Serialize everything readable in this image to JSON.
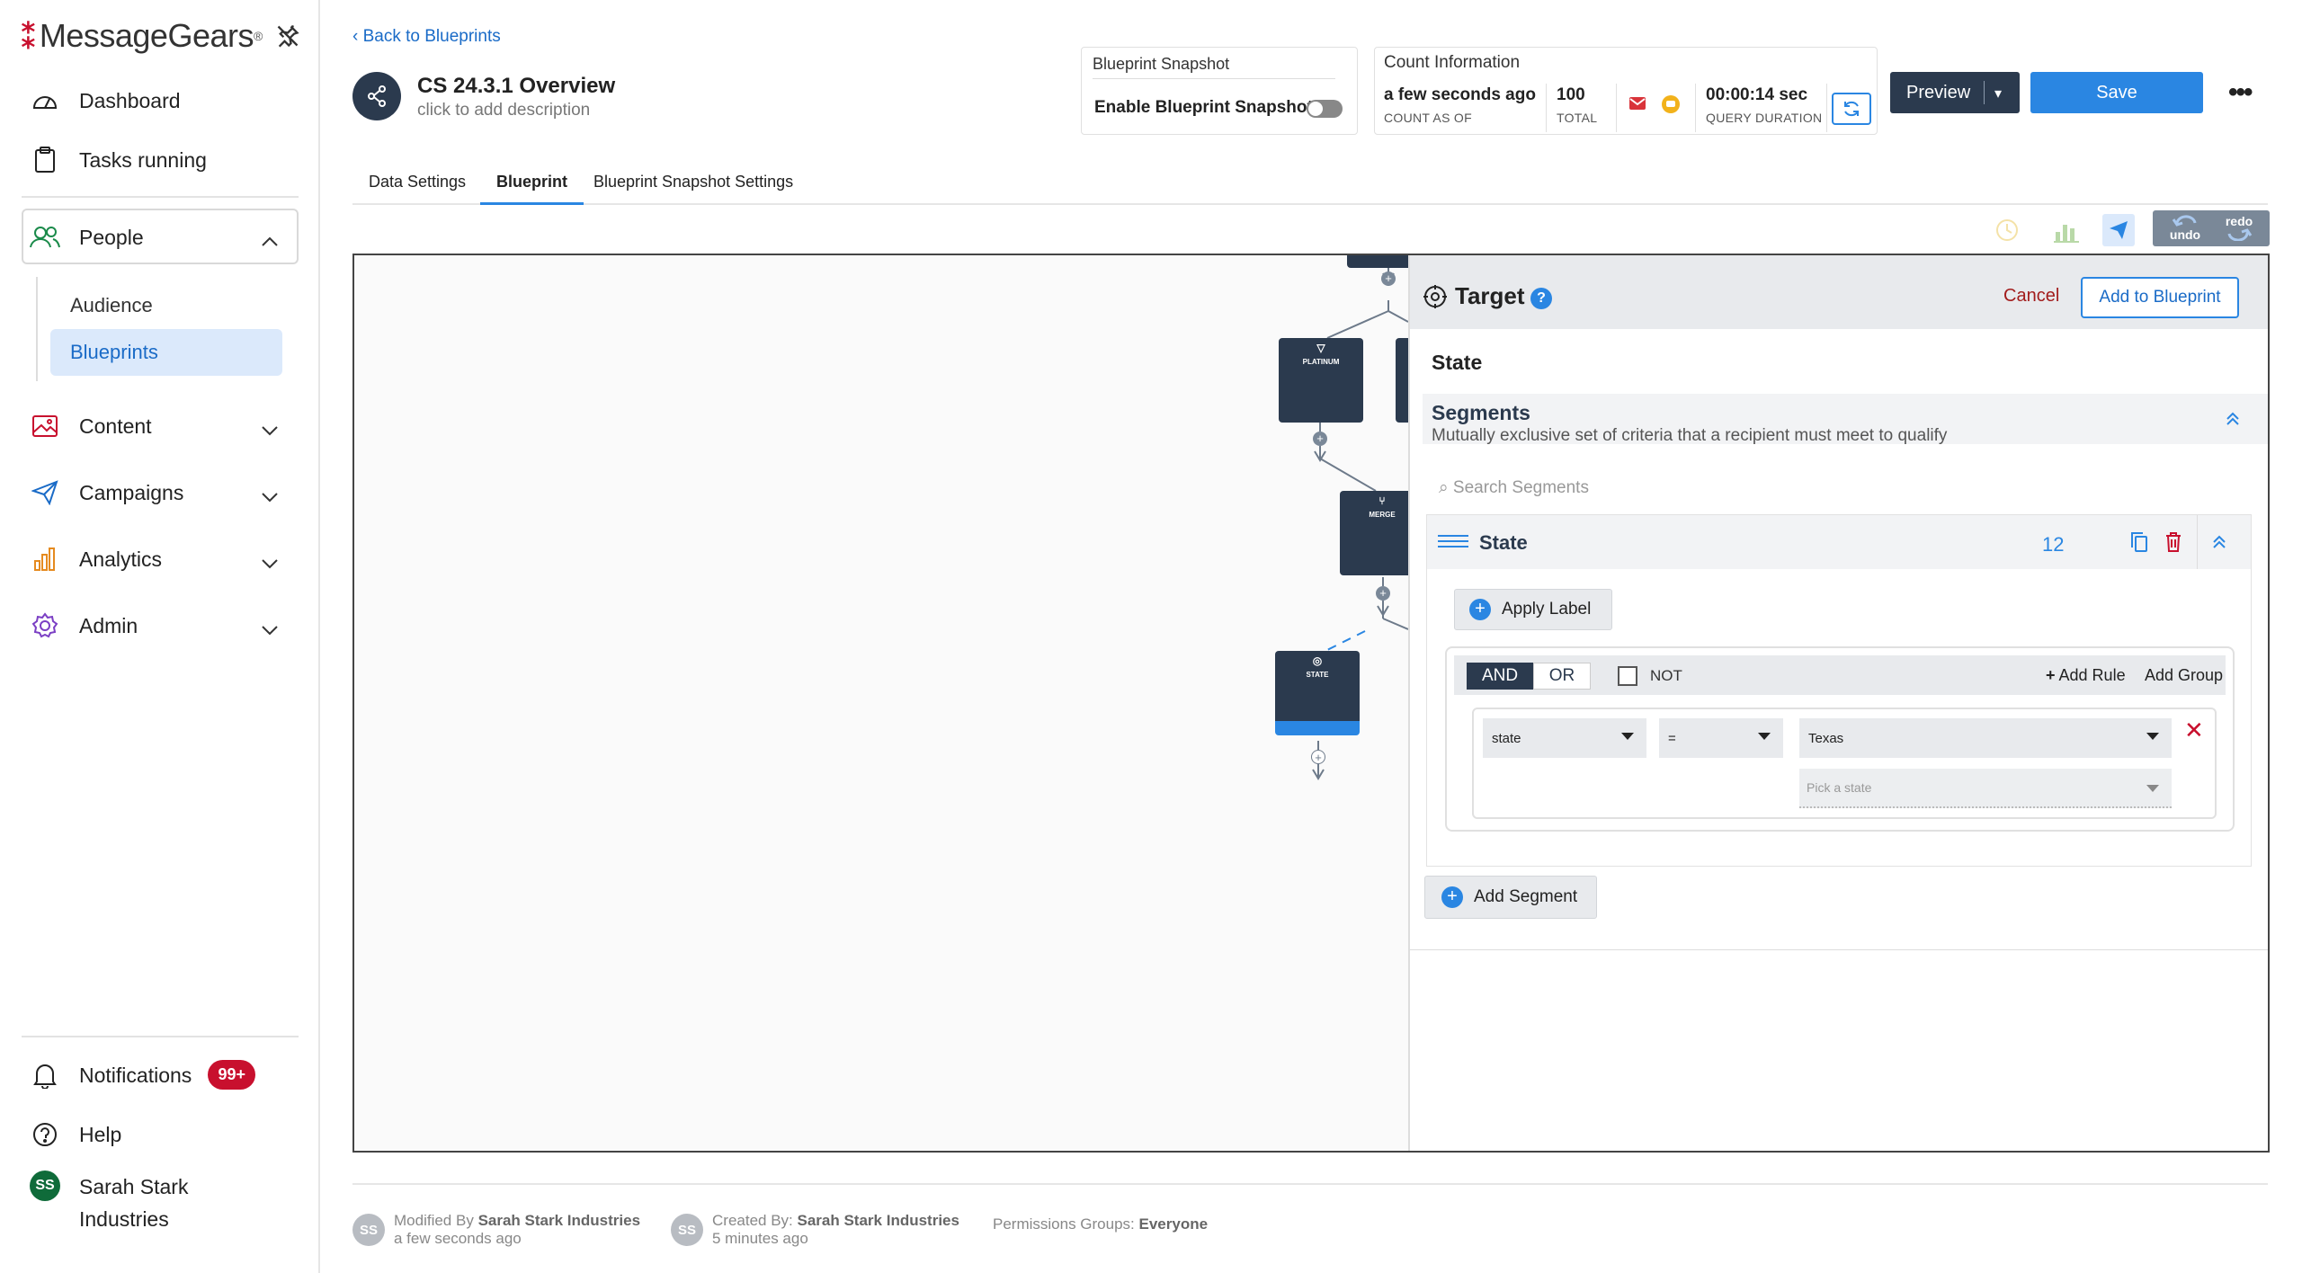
{
  "sidebar": {
    "logo": "MessageGears",
    "logo_tm": "®",
    "items": {
      "dashboard": "Dashboard",
      "tasks": "Tasks running",
      "people": "People",
      "audience": "Audience",
      "blueprints": "Blueprints",
      "content": "Content",
      "campaigns": "Campaigns",
      "analytics": "Analytics",
      "admin": "Admin",
      "notifications": "Notifications",
      "notifications_badge": "99+",
      "help": "Help"
    },
    "user": {
      "initials": "SS",
      "name_line1": "Sarah Stark",
      "name_line2": "Industries"
    }
  },
  "header": {
    "back": "Back to Blueprints",
    "title": "CS 24.3.1 Overview",
    "description": "click to add description",
    "snapshot": {
      "title": "Blueprint Snapshot",
      "label": "Enable Blueprint Snapshot",
      "enabled": false
    },
    "count": {
      "title": "Count Information",
      "as_of_value": "a few seconds ago",
      "as_of_label": "COUNT AS OF",
      "total_value": "100",
      "total_label": "TOTAL",
      "duration_value": "00:00:14 sec",
      "duration_label": "QUERY DURATION"
    },
    "preview": "Preview",
    "save": "Save",
    "more": "•••"
  },
  "tabs": [
    "Data Settings",
    "Blueprint",
    "Blueprint Snapshot Settings"
  ],
  "toolbar": {
    "undo": "undo",
    "redo": "redo"
  },
  "canvas": {
    "nodes": {
      "platinum": "PLATINUM",
      "merge": "MERGE",
      "state": "STATE"
    }
  },
  "target": {
    "title": "Target",
    "cancel": "Cancel",
    "add": "Add to Blueprint",
    "name": "State",
    "segments_title": "Segments",
    "segments_subtitle": "Mutually exclusive set of criteria that a recipient must meet to qualify",
    "search_placeholder": "Search Segments",
    "segment": {
      "name": "State",
      "count": "12",
      "apply_label": "Apply Label",
      "and": "AND",
      "or": "OR",
      "not": "NOT",
      "add_rule": "Add Rule",
      "add_group": "Add Group",
      "rule": {
        "field": "state",
        "operator": "=",
        "value": "Texas",
        "picker_placeholder": "Pick a state"
      }
    },
    "add_segment": "Add Segment"
  },
  "footer": {
    "modified_label": "Modified By",
    "modified_by": "Sarah Stark Industries",
    "modified_when": "a few seconds ago",
    "created_label": "Created By:",
    "created_by": "Sarah Stark Industries",
    "created_when": "5 minutes ago",
    "permissions_label": "Permissions Groups:",
    "permissions_value": "Everyone",
    "avatar_initials": "SS"
  },
  "colors": {
    "accent": "#2a86e2",
    "brand": "#c8102e",
    "navy": "#2b3a4e"
  }
}
